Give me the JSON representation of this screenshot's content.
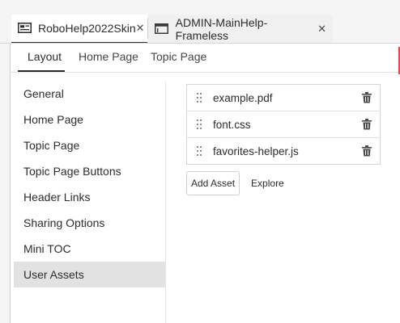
{
  "doc_tabs": [
    {
      "label": "RoboHelp2022Skin",
      "icon": "skin-icon",
      "close": "✕"
    },
    {
      "label": "ADMIN-MainHelp-Frameless",
      "icon": "window-icon",
      "close": "✕"
    }
  ],
  "sub_tabs": [
    "Layout",
    "Home Page",
    "Topic Page"
  ],
  "nav_items": [
    "General",
    "Home Page",
    "Topic Page",
    "Topic Page Buttons",
    "Header Links",
    "Sharing Options",
    "Mini TOC",
    "User Assets"
  ],
  "selected_nav": "User Assets",
  "assets": [
    "example.pdf",
    "font.css",
    "favorites-helper.js"
  ],
  "buttons": {
    "add_asset": "Add Asset",
    "explore": "Explore"
  },
  "colors": {
    "accent_marker": "#e34850",
    "selected_bg": "#e2e2e2"
  }
}
